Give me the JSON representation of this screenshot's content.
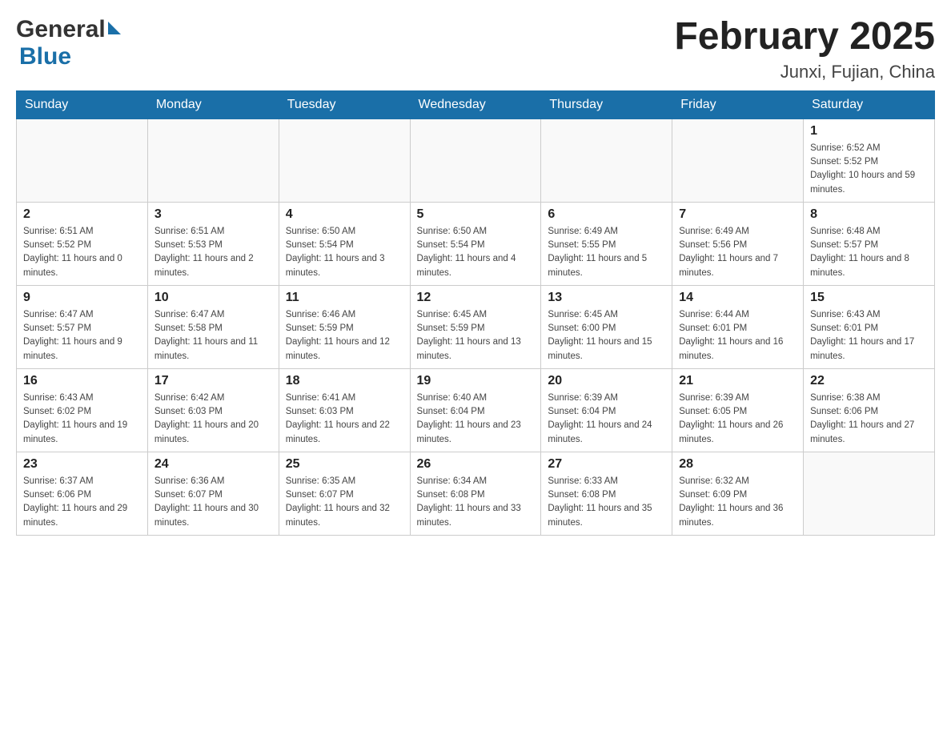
{
  "header": {
    "title": "February 2025",
    "subtitle": "Junxi, Fujian, China",
    "logo_general": "General",
    "logo_blue": "Blue"
  },
  "weekdays": [
    "Sunday",
    "Monday",
    "Tuesday",
    "Wednesday",
    "Thursday",
    "Friday",
    "Saturday"
  ],
  "weeks": [
    [
      {
        "day": "",
        "sunrise": "",
        "sunset": "",
        "daylight": ""
      },
      {
        "day": "",
        "sunrise": "",
        "sunset": "",
        "daylight": ""
      },
      {
        "day": "",
        "sunrise": "",
        "sunset": "",
        "daylight": ""
      },
      {
        "day": "",
        "sunrise": "",
        "sunset": "",
        "daylight": ""
      },
      {
        "day": "",
        "sunrise": "",
        "sunset": "",
        "daylight": ""
      },
      {
        "day": "",
        "sunrise": "",
        "sunset": "",
        "daylight": ""
      },
      {
        "day": "1",
        "sunrise": "Sunrise: 6:52 AM",
        "sunset": "Sunset: 5:52 PM",
        "daylight": "Daylight: 10 hours and 59 minutes."
      }
    ],
    [
      {
        "day": "2",
        "sunrise": "Sunrise: 6:51 AM",
        "sunset": "Sunset: 5:52 PM",
        "daylight": "Daylight: 11 hours and 0 minutes."
      },
      {
        "day": "3",
        "sunrise": "Sunrise: 6:51 AM",
        "sunset": "Sunset: 5:53 PM",
        "daylight": "Daylight: 11 hours and 2 minutes."
      },
      {
        "day": "4",
        "sunrise": "Sunrise: 6:50 AM",
        "sunset": "Sunset: 5:54 PM",
        "daylight": "Daylight: 11 hours and 3 minutes."
      },
      {
        "day": "5",
        "sunrise": "Sunrise: 6:50 AM",
        "sunset": "Sunset: 5:54 PM",
        "daylight": "Daylight: 11 hours and 4 minutes."
      },
      {
        "day": "6",
        "sunrise": "Sunrise: 6:49 AM",
        "sunset": "Sunset: 5:55 PM",
        "daylight": "Daylight: 11 hours and 5 minutes."
      },
      {
        "day": "7",
        "sunrise": "Sunrise: 6:49 AM",
        "sunset": "Sunset: 5:56 PM",
        "daylight": "Daylight: 11 hours and 7 minutes."
      },
      {
        "day": "8",
        "sunrise": "Sunrise: 6:48 AM",
        "sunset": "Sunset: 5:57 PM",
        "daylight": "Daylight: 11 hours and 8 minutes."
      }
    ],
    [
      {
        "day": "9",
        "sunrise": "Sunrise: 6:47 AM",
        "sunset": "Sunset: 5:57 PM",
        "daylight": "Daylight: 11 hours and 9 minutes."
      },
      {
        "day": "10",
        "sunrise": "Sunrise: 6:47 AM",
        "sunset": "Sunset: 5:58 PM",
        "daylight": "Daylight: 11 hours and 11 minutes."
      },
      {
        "day": "11",
        "sunrise": "Sunrise: 6:46 AM",
        "sunset": "Sunset: 5:59 PM",
        "daylight": "Daylight: 11 hours and 12 minutes."
      },
      {
        "day": "12",
        "sunrise": "Sunrise: 6:45 AM",
        "sunset": "Sunset: 5:59 PM",
        "daylight": "Daylight: 11 hours and 13 minutes."
      },
      {
        "day": "13",
        "sunrise": "Sunrise: 6:45 AM",
        "sunset": "Sunset: 6:00 PM",
        "daylight": "Daylight: 11 hours and 15 minutes."
      },
      {
        "day": "14",
        "sunrise": "Sunrise: 6:44 AM",
        "sunset": "Sunset: 6:01 PM",
        "daylight": "Daylight: 11 hours and 16 minutes."
      },
      {
        "day": "15",
        "sunrise": "Sunrise: 6:43 AM",
        "sunset": "Sunset: 6:01 PM",
        "daylight": "Daylight: 11 hours and 17 minutes."
      }
    ],
    [
      {
        "day": "16",
        "sunrise": "Sunrise: 6:43 AM",
        "sunset": "Sunset: 6:02 PM",
        "daylight": "Daylight: 11 hours and 19 minutes."
      },
      {
        "day": "17",
        "sunrise": "Sunrise: 6:42 AM",
        "sunset": "Sunset: 6:03 PM",
        "daylight": "Daylight: 11 hours and 20 minutes."
      },
      {
        "day": "18",
        "sunrise": "Sunrise: 6:41 AM",
        "sunset": "Sunset: 6:03 PM",
        "daylight": "Daylight: 11 hours and 22 minutes."
      },
      {
        "day": "19",
        "sunrise": "Sunrise: 6:40 AM",
        "sunset": "Sunset: 6:04 PM",
        "daylight": "Daylight: 11 hours and 23 minutes."
      },
      {
        "day": "20",
        "sunrise": "Sunrise: 6:39 AM",
        "sunset": "Sunset: 6:04 PM",
        "daylight": "Daylight: 11 hours and 24 minutes."
      },
      {
        "day": "21",
        "sunrise": "Sunrise: 6:39 AM",
        "sunset": "Sunset: 6:05 PM",
        "daylight": "Daylight: 11 hours and 26 minutes."
      },
      {
        "day": "22",
        "sunrise": "Sunrise: 6:38 AM",
        "sunset": "Sunset: 6:06 PM",
        "daylight": "Daylight: 11 hours and 27 minutes."
      }
    ],
    [
      {
        "day": "23",
        "sunrise": "Sunrise: 6:37 AM",
        "sunset": "Sunset: 6:06 PM",
        "daylight": "Daylight: 11 hours and 29 minutes."
      },
      {
        "day": "24",
        "sunrise": "Sunrise: 6:36 AM",
        "sunset": "Sunset: 6:07 PM",
        "daylight": "Daylight: 11 hours and 30 minutes."
      },
      {
        "day": "25",
        "sunrise": "Sunrise: 6:35 AM",
        "sunset": "Sunset: 6:07 PM",
        "daylight": "Daylight: 11 hours and 32 minutes."
      },
      {
        "day": "26",
        "sunrise": "Sunrise: 6:34 AM",
        "sunset": "Sunset: 6:08 PM",
        "daylight": "Daylight: 11 hours and 33 minutes."
      },
      {
        "day": "27",
        "sunrise": "Sunrise: 6:33 AM",
        "sunset": "Sunset: 6:08 PM",
        "daylight": "Daylight: 11 hours and 35 minutes."
      },
      {
        "day": "28",
        "sunrise": "Sunrise: 6:32 AM",
        "sunset": "Sunset: 6:09 PM",
        "daylight": "Daylight: 11 hours and 36 minutes."
      },
      {
        "day": "",
        "sunrise": "",
        "sunset": "",
        "daylight": ""
      }
    ]
  ]
}
